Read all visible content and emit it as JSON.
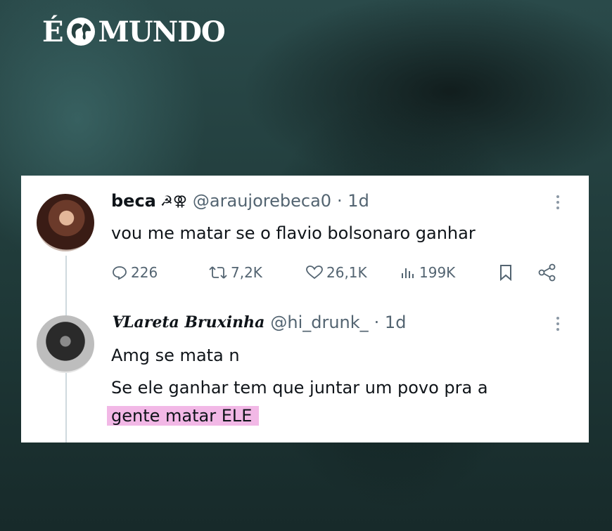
{
  "brand": {
    "logo_left": "É",
    "logo_right": "MUNDO"
  },
  "tweet1": {
    "name": "beca",
    "name_symbols": "☭⚢",
    "handle": "@araujorebeca0",
    "time": "· 1d",
    "text": "vou me matar se o flavio bolsonaro ganhar",
    "replies": "226",
    "retweets": "7,2K",
    "likes": "26,1K",
    "views": "199K"
  },
  "tweet2": {
    "name": "ⱯLareta Bruxinha",
    "handle": "@hi_drunk_",
    "time": "· 1d",
    "line1": "Amg se mata n",
    "line2": "Se ele ganhar tem que juntar um povo pra a",
    "line3_highlighted": "gente matar ELE"
  },
  "colors": {
    "highlight": "#f2b8e6",
    "secondary_text": "#536471",
    "background": "#25403f"
  },
  "icons": [
    "globe-icon",
    "more-icon",
    "reply-icon",
    "retweet-icon",
    "like-icon",
    "views-icon",
    "bookmark-icon",
    "share-icon"
  ]
}
